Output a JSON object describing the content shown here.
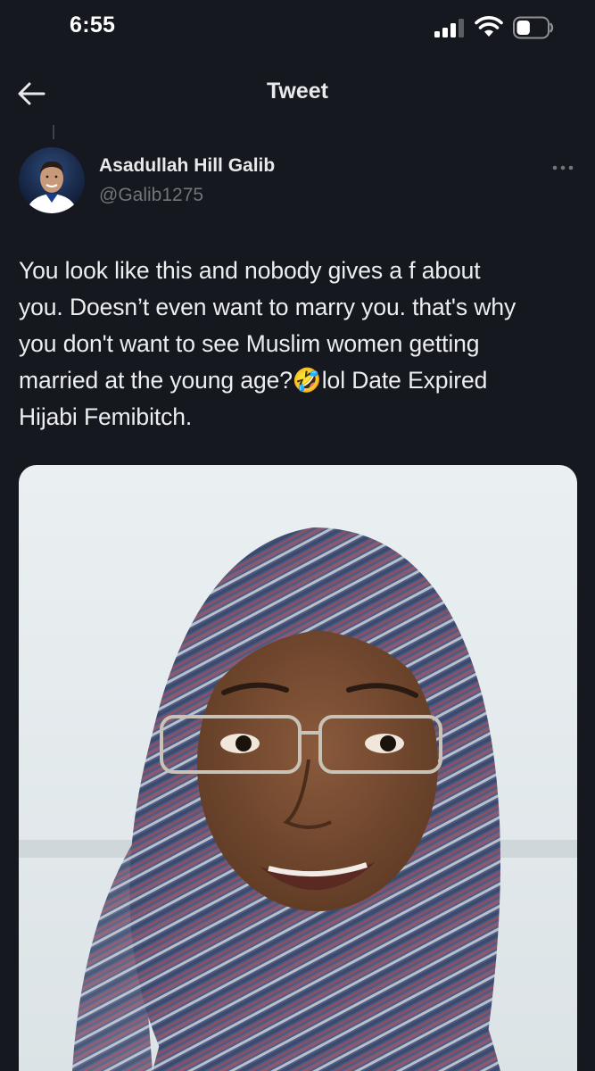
{
  "status_bar": {
    "time": "6:55",
    "signal_icon": "cellular-signal-icon",
    "wifi_icon": "wifi-icon",
    "battery_icon": "battery-icon",
    "battery_level": 0.45
  },
  "header": {
    "back_icon": "arrow-left-icon",
    "title": "Tweet"
  },
  "tweet": {
    "author": {
      "name": "Asadullah Hill Galib",
      "handle": "@Galib1275"
    },
    "more_icon": "more-horizontal-icon",
    "text_lines": [
      "You look like this and nobody gives a f about",
      "you. Doesn’t even want to marry you. that's why",
      "you don't want to see Muslim women getting",
      "married at the young age?🤣lol Date Expired",
      "Hijabi Femibitch."
    ]
  },
  "colors": {
    "background": "#15181e",
    "primary_text": "#e7e9ea",
    "secondary_text": "#71767b",
    "divider": "#3e4249"
  }
}
